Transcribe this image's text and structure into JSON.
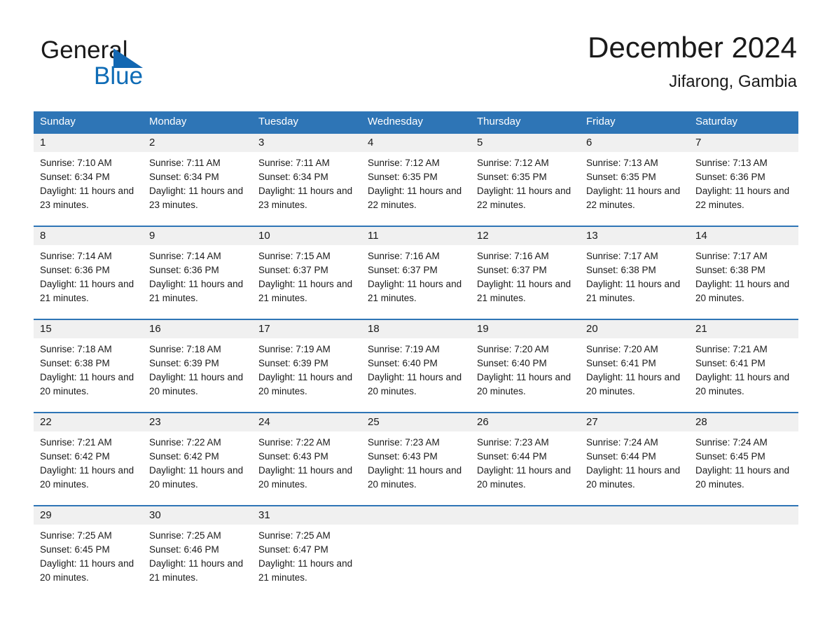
{
  "brand": {
    "name_part1": "General",
    "name_part2": "Blue",
    "accent_color": "#0f6cb6",
    "triangle_color": "#1267b2"
  },
  "header": {
    "title": "December 2024",
    "subtitle": "Jifarong, Gambia"
  },
  "theme": {
    "header_blue": "#2e75b6",
    "day_band_gray": "#f0f0f0",
    "text_color": "#1a1a1a"
  },
  "weekdays": [
    "Sunday",
    "Monday",
    "Tuesday",
    "Wednesday",
    "Thursday",
    "Friday",
    "Saturday"
  ],
  "weeks": [
    [
      {
        "day": "1",
        "sunrise": "Sunrise: 7:10 AM",
        "sunset": "Sunset: 6:34 PM",
        "daylight": "Daylight: 11 hours and 23 minutes."
      },
      {
        "day": "2",
        "sunrise": "Sunrise: 7:11 AM",
        "sunset": "Sunset: 6:34 PM",
        "daylight": "Daylight: 11 hours and 23 minutes."
      },
      {
        "day": "3",
        "sunrise": "Sunrise: 7:11 AM",
        "sunset": "Sunset: 6:34 PM",
        "daylight": "Daylight: 11 hours and 23 minutes."
      },
      {
        "day": "4",
        "sunrise": "Sunrise: 7:12 AM",
        "sunset": "Sunset: 6:35 PM",
        "daylight": "Daylight: 11 hours and 22 minutes."
      },
      {
        "day": "5",
        "sunrise": "Sunrise: 7:12 AM",
        "sunset": "Sunset: 6:35 PM",
        "daylight": "Daylight: 11 hours and 22 minutes."
      },
      {
        "day": "6",
        "sunrise": "Sunrise: 7:13 AM",
        "sunset": "Sunset: 6:35 PM",
        "daylight": "Daylight: 11 hours and 22 minutes."
      },
      {
        "day": "7",
        "sunrise": "Sunrise: 7:13 AM",
        "sunset": "Sunset: 6:36 PM",
        "daylight": "Daylight: 11 hours and 22 minutes."
      }
    ],
    [
      {
        "day": "8",
        "sunrise": "Sunrise: 7:14 AM",
        "sunset": "Sunset: 6:36 PM",
        "daylight": "Daylight: 11 hours and 21 minutes."
      },
      {
        "day": "9",
        "sunrise": "Sunrise: 7:14 AM",
        "sunset": "Sunset: 6:36 PM",
        "daylight": "Daylight: 11 hours and 21 minutes."
      },
      {
        "day": "10",
        "sunrise": "Sunrise: 7:15 AM",
        "sunset": "Sunset: 6:37 PM",
        "daylight": "Daylight: 11 hours and 21 minutes."
      },
      {
        "day": "11",
        "sunrise": "Sunrise: 7:16 AM",
        "sunset": "Sunset: 6:37 PM",
        "daylight": "Daylight: 11 hours and 21 minutes."
      },
      {
        "day": "12",
        "sunrise": "Sunrise: 7:16 AM",
        "sunset": "Sunset: 6:37 PM",
        "daylight": "Daylight: 11 hours and 21 minutes."
      },
      {
        "day": "13",
        "sunrise": "Sunrise: 7:17 AM",
        "sunset": "Sunset: 6:38 PM",
        "daylight": "Daylight: 11 hours and 21 minutes."
      },
      {
        "day": "14",
        "sunrise": "Sunrise: 7:17 AM",
        "sunset": "Sunset: 6:38 PM",
        "daylight": "Daylight: 11 hours and 20 minutes."
      }
    ],
    [
      {
        "day": "15",
        "sunrise": "Sunrise: 7:18 AM",
        "sunset": "Sunset: 6:38 PM",
        "daylight": "Daylight: 11 hours and 20 minutes."
      },
      {
        "day": "16",
        "sunrise": "Sunrise: 7:18 AM",
        "sunset": "Sunset: 6:39 PM",
        "daylight": "Daylight: 11 hours and 20 minutes."
      },
      {
        "day": "17",
        "sunrise": "Sunrise: 7:19 AM",
        "sunset": "Sunset: 6:39 PM",
        "daylight": "Daylight: 11 hours and 20 minutes."
      },
      {
        "day": "18",
        "sunrise": "Sunrise: 7:19 AM",
        "sunset": "Sunset: 6:40 PM",
        "daylight": "Daylight: 11 hours and 20 minutes."
      },
      {
        "day": "19",
        "sunrise": "Sunrise: 7:20 AM",
        "sunset": "Sunset: 6:40 PM",
        "daylight": "Daylight: 11 hours and 20 minutes."
      },
      {
        "day": "20",
        "sunrise": "Sunrise: 7:20 AM",
        "sunset": "Sunset: 6:41 PM",
        "daylight": "Daylight: 11 hours and 20 minutes."
      },
      {
        "day": "21",
        "sunrise": "Sunrise: 7:21 AM",
        "sunset": "Sunset: 6:41 PM",
        "daylight": "Daylight: 11 hours and 20 minutes."
      }
    ],
    [
      {
        "day": "22",
        "sunrise": "Sunrise: 7:21 AM",
        "sunset": "Sunset: 6:42 PM",
        "daylight": "Daylight: 11 hours and 20 minutes."
      },
      {
        "day": "23",
        "sunrise": "Sunrise: 7:22 AM",
        "sunset": "Sunset: 6:42 PM",
        "daylight": "Daylight: 11 hours and 20 minutes."
      },
      {
        "day": "24",
        "sunrise": "Sunrise: 7:22 AM",
        "sunset": "Sunset: 6:43 PM",
        "daylight": "Daylight: 11 hours and 20 minutes."
      },
      {
        "day": "25",
        "sunrise": "Sunrise: 7:23 AM",
        "sunset": "Sunset: 6:43 PM",
        "daylight": "Daylight: 11 hours and 20 minutes."
      },
      {
        "day": "26",
        "sunrise": "Sunrise: 7:23 AM",
        "sunset": "Sunset: 6:44 PM",
        "daylight": "Daylight: 11 hours and 20 minutes."
      },
      {
        "day": "27",
        "sunrise": "Sunrise: 7:24 AM",
        "sunset": "Sunset: 6:44 PM",
        "daylight": "Daylight: 11 hours and 20 minutes."
      },
      {
        "day": "28",
        "sunrise": "Sunrise: 7:24 AM",
        "sunset": "Sunset: 6:45 PM",
        "daylight": "Daylight: 11 hours and 20 minutes."
      }
    ],
    [
      {
        "day": "29",
        "sunrise": "Sunrise: 7:25 AM",
        "sunset": "Sunset: 6:45 PM",
        "daylight": "Daylight: 11 hours and 20 minutes."
      },
      {
        "day": "30",
        "sunrise": "Sunrise: 7:25 AM",
        "sunset": "Sunset: 6:46 PM",
        "daylight": "Daylight: 11 hours and 21 minutes."
      },
      {
        "day": "31",
        "sunrise": "Sunrise: 7:25 AM",
        "sunset": "Sunset: 6:47 PM",
        "daylight": "Daylight: 11 hours and 21 minutes."
      },
      {
        "day": "",
        "sunrise": "",
        "sunset": "",
        "daylight": ""
      },
      {
        "day": "",
        "sunrise": "",
        "sunset": "",
        "daylight": ""
      },
      {
        "day": "",
        "sunrise": "",
        "sunset": "",
        "daylight": ""
      },
      {
        "day": "",
        "sunrise": "",
        "sunset": "",
        "daylight": ""
      }
    ]
  ]
}
